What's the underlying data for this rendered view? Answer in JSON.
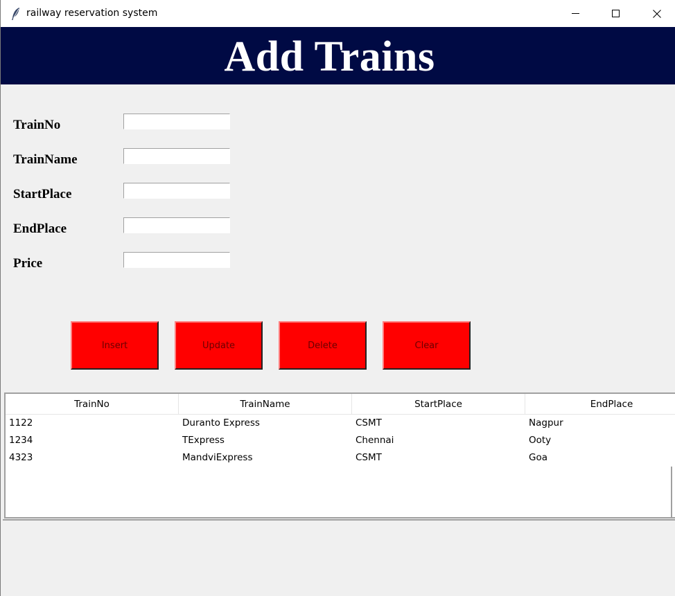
{
  "window": {
    "title": "railway reservation system",
    "icon": "feather-icon",
    "controls": [
      "minimize-icon",
      "maximize-icon",
      "close-icon"
    ]
  },
  "header": {
    "title": "Add Trains",
    "background": "#000a44",
    "color": "#ffffff"
  },
  "form": {
    "fields": [
      {
        "label": "TrainNo",
        "value": ""
      },
      {
        "label": "TrainName",
        "value": ""
      },
      {
        "label": "StartPlace",
        "value": ""
      },
      {
        "label": "EndPlace",
        "value": ""
      },
      {
        "label": "Price",
        "value": ""
      }
    ]
  },
  "buttons": {
    "insert": "Insert",
    "update": "Update",
    "delete": "Delete",
    "clear": "Clear",
    "color": "#ff0000"
  },
  "table": {
    "columns": [
      "TrainNo",
      "TrainName",
      "StartPlace",
      "EndPlace"
    ],
    "rows": [
      [
        "1122",
        "Duranto Express",
        "CSMT",
        "Nagpur"
      ],
      [
        "1234",
        "TExpress",
        "Chennai",
        "Ooty"
      ],
      [
        "4323",
        "MandviExpress",
        "CSMT",
        "Goa"
      ]
    ]
  }
}
